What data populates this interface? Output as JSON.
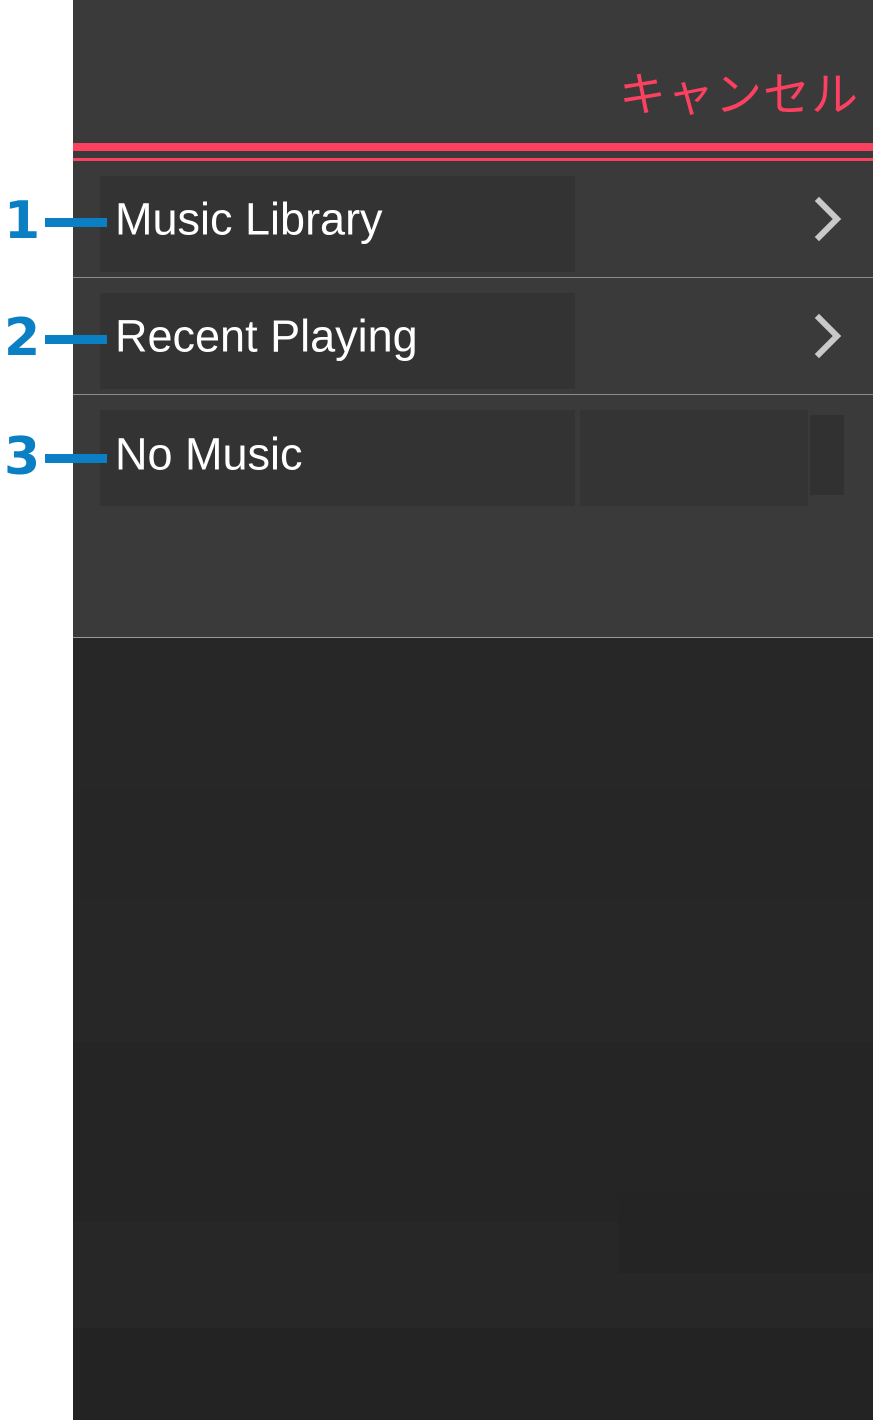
{
  "theme": {
    "surface_background": "#3a3a3a",
    "body_background": "#272727",
    "accent_rule_color": "#fb4060",
    "cancel_text_color": "#fb4060",
    "row_label_color": "#ffffff",
    "divider_color": "#8d8d8d",
    "annotation_color": "#0b7fc4"
  },
  "sheet": {
    "cancel_label": "キャンセル",
    "rows": [
      {
        "label": "Music Library",
        "chevron": "chevron-right-icon",
        "has_chevron": true
      },
      {
        "label": "Recent Playing",
        "chevron": "chevron-right-icon",
        "has_chevron": true
      },
      {
        "label": "No Music",
        "chevron": "",
        "has_chevron": false
      }
    ]
  },
  "annotations": [
    {
      "number": "1",
      "target": "Music Library"
    },
    {
      "number": "2",
      "target": "Recent Playing"
    },
    {
      "number": "3",
      "target": "No Music"
    }
  ]
}
